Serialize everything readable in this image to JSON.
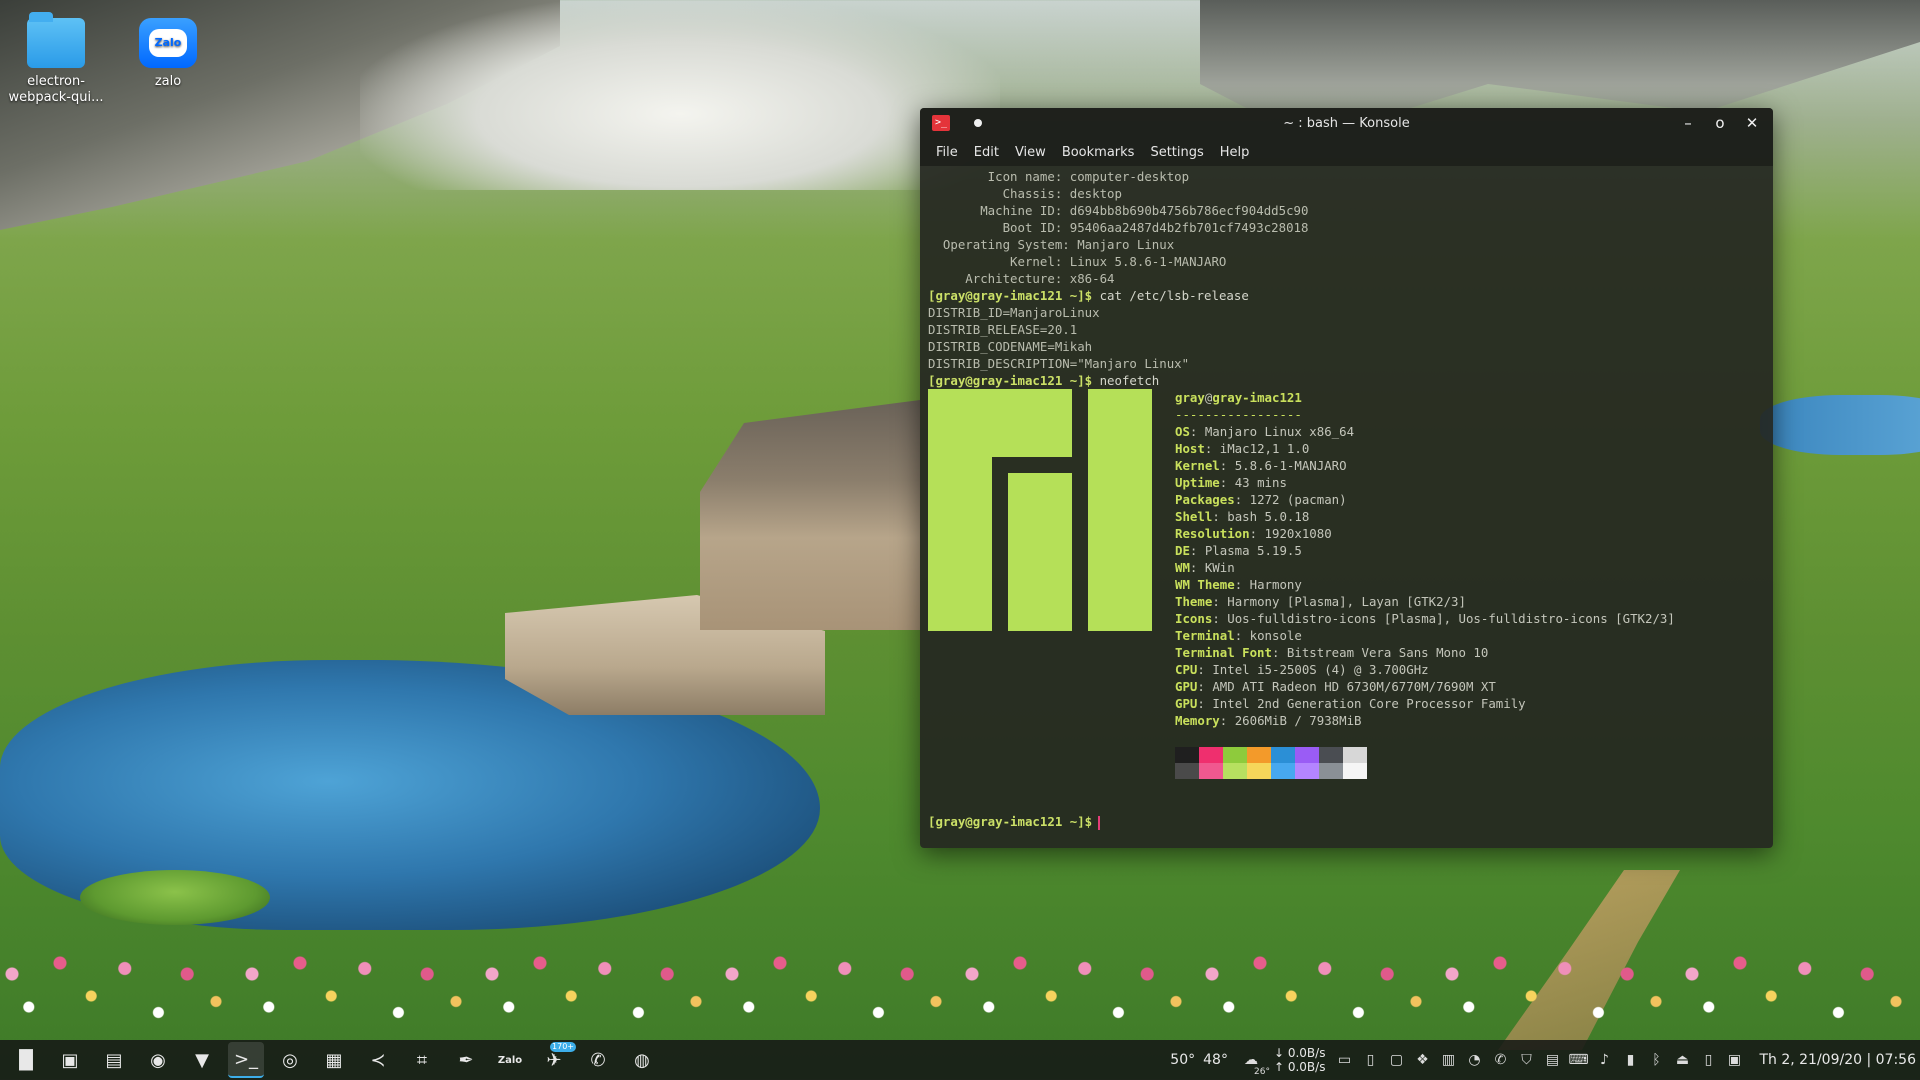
{
  "desktop": {
    "icons": [
      {
        "label": "electron-\nwebpack-qui...",
        "icon": "folder-icon"
      },
      {
        "label": "zalo",
        "icon": "zalo-app-icon",
        "glyph": "Zalo"
      }
    ]
  },
  "window": {
    "title": "~ : bash — Konsole",
    "app_icon_glyph": ">_",
    "controls": {
      "minimize": "–",
      "maximize": "o",
      "close": "✕"
    },
    "menu": [
      "File",
      "Edit",
      "View",
      "Bookmarks",
      "Settings",
      "Help"
    ]
  },
  "terminal": {
    "hostnamectl": [
      "        Icon name: computer-desktop",
      "          Chassis: desktop",
      "       Machine ID: d694bb8b690b4756b786ecf904dd5c90",
      "          Boot ID: 95406aa2487d4b2fb701cf7493c28018",
      "  Operating System: Manjaro Linux",
      "           Kernel: Linux 5.8.6-1-MANJARO",
      "     Architecture: x86-64"
    ],
    "prompt": "[gray@gray-imac121 ~]$",
    "cmd1": " cat /etc/lsb-release",
    "lsb": [
      "DISTRIB_ID=ManjaroLinux",
      "DISTRIB_RELEASE=20.1",
      "DISTRIB_CODENAME=Mikah",
      "DISTRIB_DESCRIPTION=\"Manjaro Linux\""
    ],
    "cmd2": " neofetch",
    "neofetch": {
      "user": "gray",
      "at": "@",
      "host": "gray-imac121",
      "separator": "-----------------",
      "fields": [
        {
          "key": "OS",
          "value": "Manjaro Linux x86_64"
        },
        {
          "key": "Host",
          "value": "iMac12,1 1.0"
        },
        {
          "key": "Kernel",
          "value": "5.8.6-1-MANJARO"
        },
        {
          "key": "Uptime",
          "value": "43 mins"
        },
        {
          "key": "Packages",
          "value": "1272 (pacman)"
        },
        {
          "key": "Shell",
          "value": "bash 5.0.18"
        },
        {
          "key": "Resolution",
          "value": "1920x1080"
        },
        {
          "key": "DE",
          "value": "Plasma 5.19.5"
        },
        {
          "key": "WM",
          "value": "KWin"
        },
        {
          "key": "WM Theme",
          "value": "Harmony"
        },
        {
          "key": "Theme",
          "value": "Harmony [Plasma], Layan [GTK2/3]"
        },
        {
          "key": "Icons",
          "value": "Uos-fulldistro-icons [Plasma], Uos-fulldistro-icons [GTK2/3]"
        },
        {
          "key": "Terminal",
          "value": "konsole"
        },
        {
          "key": "Terminal Font",
          "value": "Bitstream Vera Sans Mono 10"
        },
        {
          "key": "CPU",
          "value": "Intel i5-2500S (4) @ 3.700GHz"
        },
        {
          "key": "GPU",
          "value": "AMD ATI Radeon HD 6730M/6770M/7690M XT"
        },
        {
          "key": "GPU",
          "value": "Intel 2nd Generation Core Processor Family"
        },
        {
          "key": "Memory",
          "value": "2606MiB / 7938MiB"
        }
      ],
      "palette_top": [
        "#1f1f1f",
        "#ef2f6e",
        "#8ecb3c",
        "#f39a2a",
        "#2b8fd6",
        "#9a5cf5",
        "#4a4d52",
        "#d7d7d7"
      ],
      "palette_bottom": [
        "#4a4a4a",
        "#f0588f",
        "#b7e060",
        "#f6d65a",
        "#47a8ef",
        "#b485ff",
        "#8a9096",
        "#f5f5f5"
      ],
      "logo_color": "#b5e058"
    },
    "final_prompt": "[gray@gray-imac121 ~]$"
  },
  "taskbar": {
    "apps": [
      {
        "name": "application-launcher",
        "glyph": "▐▌"
      },
      {
        "name": "show-desktop",
        "glyph": "▣"
      },
      {
        "name": "file-manager",
        "glyph": "▤"
      },
      {
        "name": "firefox",
        "glyph": "◉"
      },
      {
        "name": "brave",
        "glyph": "▼"
      },
      {
        "name": "konsole",
        "glyph": ">_"
      },
      {
        "name": "chromium",
        "glyph": "◎"
      },
      {
        "name": "system-monitor",
        "glyph": "▦"
      },
      {
        "name": "vscode",
        "glyph": "≺"
      },
      {
        "name": "screenshot-crop",
        "glyph": "⌗"
      },
      {
        "name": "inkscape",
        "glyph": "✒"
      },
      {
        "name": "zalo",
        "glyph": "Zalo"
      },
      {
        "name": "telegram",
        "glyph": "✈",
        "badge": "170+"
      },
      {
        "name": "viber",
        "glyph": "✆"
      },
      {
        "name": "chrome",
        "glyph": "◍"
      }
    ],
    "temps": [
      "50°",
      "48°"
    ],
    "weather": "☁",
    "weather_temp": "26°",
    "net_down": "0.0B/s",
    "net_up": "0.0B/s",
    "net_down_arrow": "↓",
    "net_up_arrow": "↑",
    "tray_icons": [
      {
        "name": "folder",
        "glyph": "▭"
      },
      {
        "name": "trash",
        "glyph": "▯"
      },
      {
        "name": "display",
        "glyph": "▢"
      },
      {
        "name": "dropbox",
        "glyph": "❖"
      },
      {
        "name": "system-monitor",
        "glyph": "▥"
      },
      {
        "name": "network",
        "glyph": "◔"
      },
      {
        "name": "viber",
        "glyph": "✆"
      },
      {
        "name": "security",
        "glyph": "⛉"
      },
      {
        "name": "clipboard",
        "glyph": "▤"
      },
      {
        "name": "keyboard",
        "glyph": "⌨"
      },
      {
        "name": "volume",
        "glyph": "♪"
      },
      {
        "name": "battery",
        "glyph": "▮"
      },
      {
        "name": "bluetooth",
        "glyph": "ᛒ"
      },
      {
        "name": "usb",
        "glyph": "⏏"
      },
      {
        "name": "phone",
        "glyph": "▯"
      },
      {
        "name": "notifications",
        "glyph": "▣"
      }
    ],
    "clock": "Th 2, 21/09/20 | 07:56"
  }
}
